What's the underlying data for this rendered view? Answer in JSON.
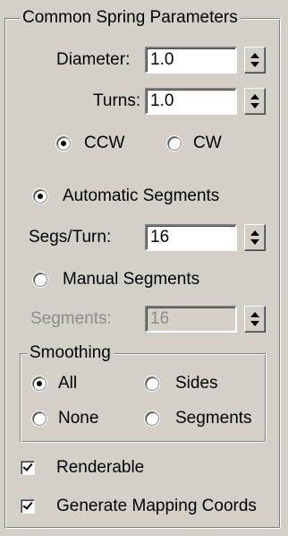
{
  "group_title": "Common Spring Parameters",
  "diameter": {
    "label": "Diameter:",
    "value": "1.0"
  },
  "turns": {
    "label": "Turns:",
    "value": "1.0"
  },
  "direction": {
    "ccw_label": "CCW",
    "cw_label": "CW",
    "selected": "CCW"
  },
  "segments_mode": {
    "automatic_label": "Automatic Segments",
    "manual_label": "Manual Segments",
    "selected": "Automatic Segments"
  },
  "segs_per_turn": {
    "label": "Segs/Turn:",
    "value": "16"
  },
  "segments": {
    "label": "Segments:",
    "value": "16",
    "enabled": false
  },
  "smoothing": {
    "title": "Smoothing",
    "all_label": "All",
    "sides_label": "Sides",
    "none_label": "None",
    "segments_label": "Segments",
    "selected": "All"
  },
  "renderable": {
    "label": "Renderable",
    "checked": true
  },
  "generate_mapping": {
    "label": "Generate Mapping Coords",
    "checked": true
  }
}
